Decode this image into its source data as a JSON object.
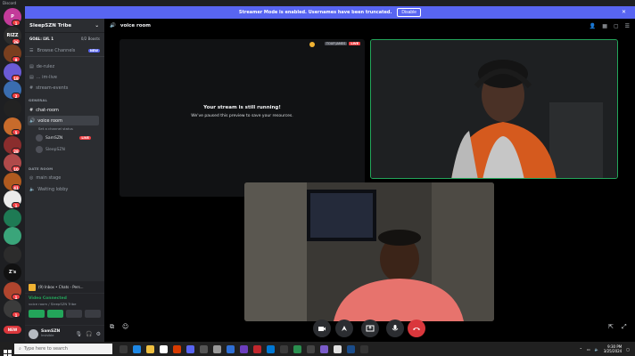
{
  "window": {
    "title": "Discord"
  },
  "banner": {
    "text": "Streamer Mode is enabled. Usernames have been truncated.",
    "disable_label": "Disable"
  },
  "rail": {
    "servers": [
      {
        "label": "P",
        "color": "#c33b9a",
        "badge": "1"
      },
      {
        "label": "RIZZ",
        "color": "#2d2d2d",
        "badge": "26"
      },
      {
        "label": "",
        "color": "#7a3f1f",
        "badge": "9"
      },
      {
        "label": "",
        "color": "#6b5bd6",
        "badge": "18"
      },
      {
        "label": "",
        "color": "#3a6db0",
        "badge": "2"
      },
      {
        "label": "",
        "color": "#222",
        "badge": ""
      },
      {
        "label": "",
        "color": "#c86b2b",
        "badge": "5"
      },
      {
        "label": "",
        "color": "#8a2d2d",
        "badge": "28"
      },
      {
        "label": "",
        "color": "#b04a4a",
        "badge": "10"
      },
      {
        "label": "",
        "color": "#b05a1f",
        "badge": "41"
      },
      {
        "label": "",
        "color": "#eaeaea",
        "badge": "1"
      },
      {
        "label": "",
        "color": "#1e7a54",
        "badge": ""
      },
      {
        "label": "",
        "color": "#3aa57a",
        "badge": ""
      },
      {
        "label": "",
        "color": "#2c2c2c",
        "badge": ""
      },
      {
        "label": "Z's",
        "color": "#111",
        "badge": ""
      },
      {
        "label": "",
        "color": "#b0452e",
        "badge": "1"
      },
      {
        "label": "",
        "color": "#3b3b3b",
        "badge": "1"
      },
      {
        "label": "NEW",
        "color": "#da373c",
        "badge": ""
      }
    ]
  },
  "sidebar": {
    "server_name": "SleepSZN Tribe",
    "goal": {
      "label": "GOAL: LVL 1",
      "boosts": "0/2 Boosts"
    },
    "browse": {
      "label": "Browse Channels",
      "badge": "NEW"
    },
    "channels_top": [
      {
        "label": "de-rulez",
        "icon": "#"
      },
      {
        "label": "... im-live",
        "icon": "#"
      },
      {
        "label": "stream-events",
        "icon": "#"
      }
    ],
    "category_general": "GENERAL",
    "chat_room": "chat-room",
    "voice_room": {
      "label": "voice room",
      "status": "Set a channel status"
    },
    "vc_users": [
      {
        "name": "SamSZN",
        "live": "LIVE"
      },
      {
        "name": "SleepSZN",
        "live": ""
      }
    ],
    "category_date": "DATE ROOM",
    "date_channels": [
      "main stage",
      "Waiting lobby"
    ],
    "mini_notice": "(9) Inbox • Chats - Pers...",
    "vc_panel": {
      "status": "Video Connected",
      "sub": "voice room / SleepSZN Tribe"
    },
    "user": {
      "name": "SamSZN",
      "tag": "Invisible"
    }
  },
  "main": {
    "channel": "voice room",
    "paused": {
      "title": "Your stream is still running!",
      "subtitle": "We've paused this preview to save your resources.",
      "stream_name": "TOUP JAMES",
      "live": "LIVE"
    }
  },
  "taskbar": {
    "search_placeholder": "Type here to search",
    "time": "9:30 PM",
    "date": "3/25/2024"
  }
}
